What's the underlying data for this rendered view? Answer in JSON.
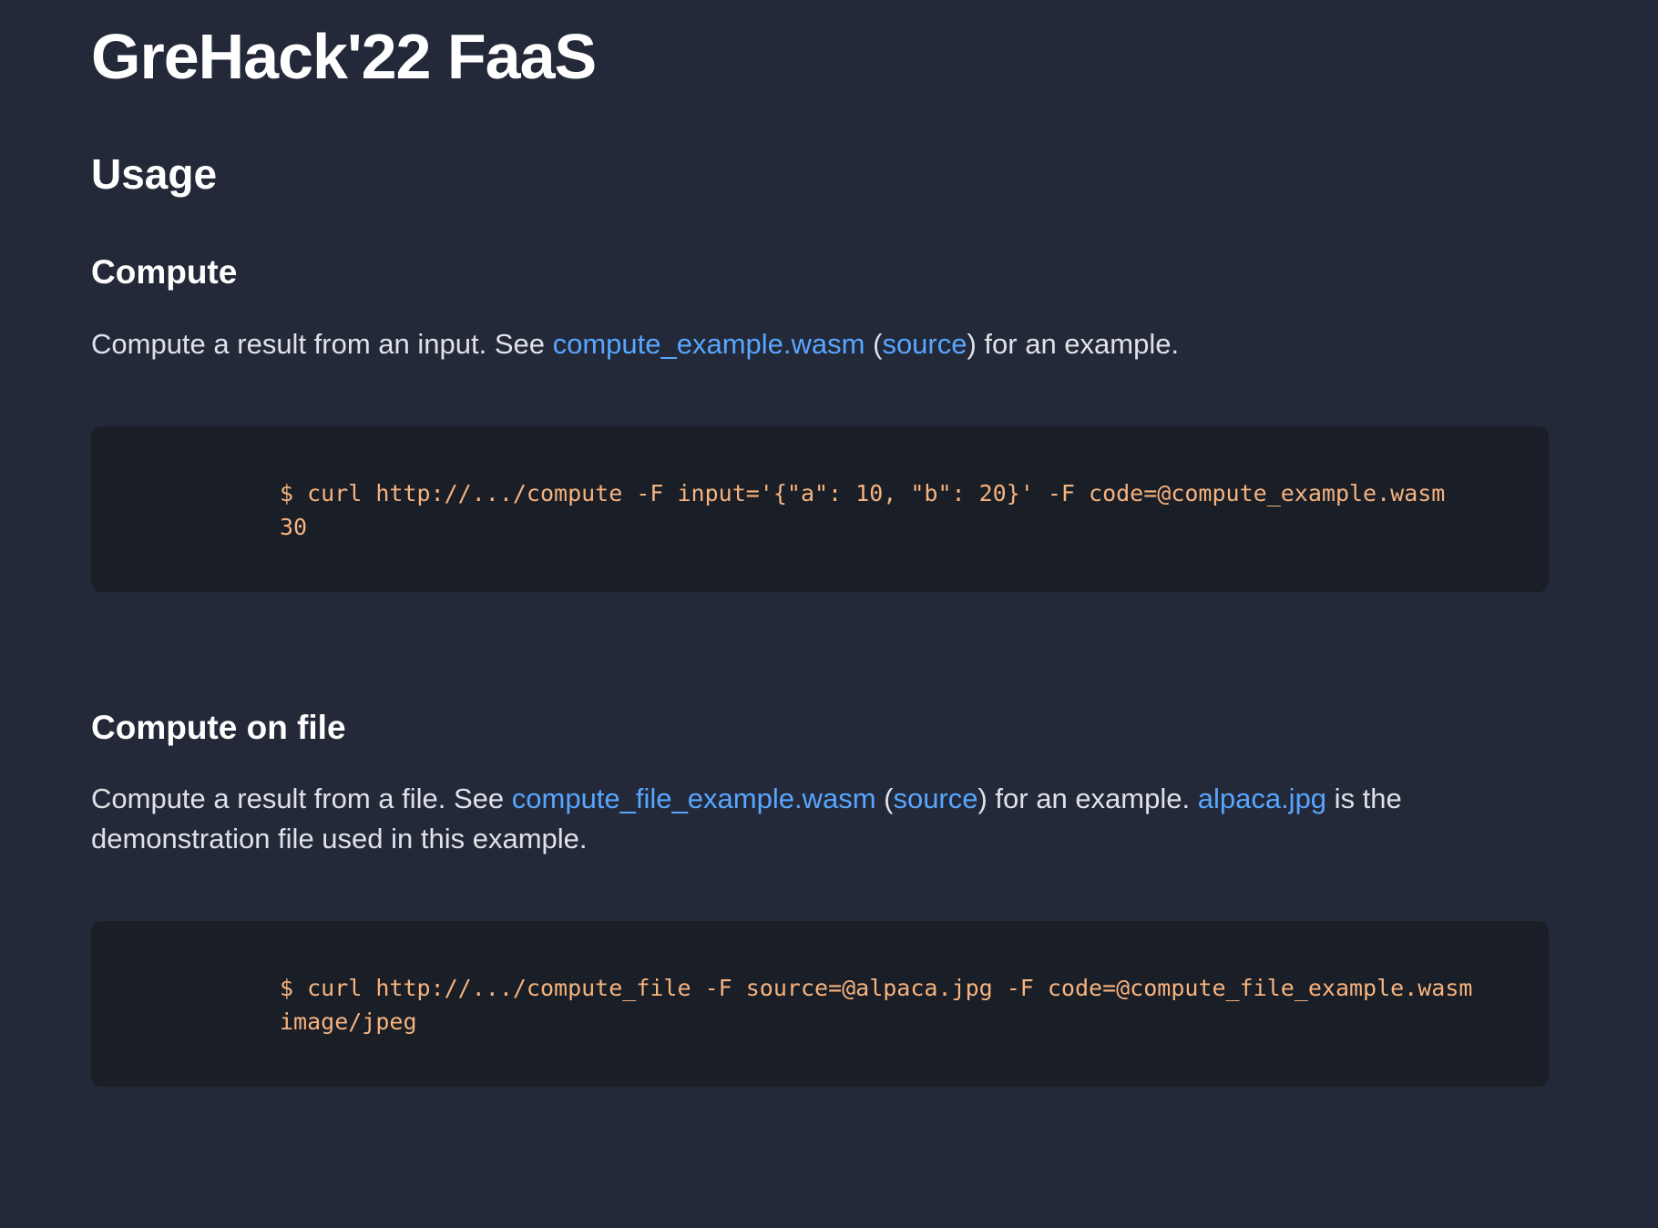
{
  "page": {
    "title": "GreHack'22 FaaS"
  },
  "usage": {
    "heading": "Usage"
  },
  "compute": {
    "heading": "Compute",
    "text_before": "Compute a result from an input. See ",
    "wasm_link": "compute_example.wasm",
    "paren_open": " (",
    "source_link": "source",
    "text_after": ") for an example.",
    "code_lines": [
      "$ curl http://.../compute -F input='{\"a\": 10, \"b\": 20}' -F code=@compute_example.wasm",
      "30"
    ]
  },
  "compute_file": {
    "heading": "Compute on file",
    "text_before": "Compute a result from a file. See ",
    "wasm_link": "compute_file_example.wasm",
    "paren_open": " (",
    "source_link": "source",
    "text_mid": ") for an example. ",
    "image_link": "alpaca.jpg",
    "text_after": " is the demonstration file used in this example.",
    "code_lines": [
      "$ curl http://.../compute_file -F source=@alpaca.jpg -F code=@compute_file_example.wasm",
      "image/jpeg"
    ]
  },
  "colors": {
    "background": "#232938",
    "code_background": "#1a1e26",
    "link": "#58a6ff",
    "code_text": "#f6b37f"
  }
}
